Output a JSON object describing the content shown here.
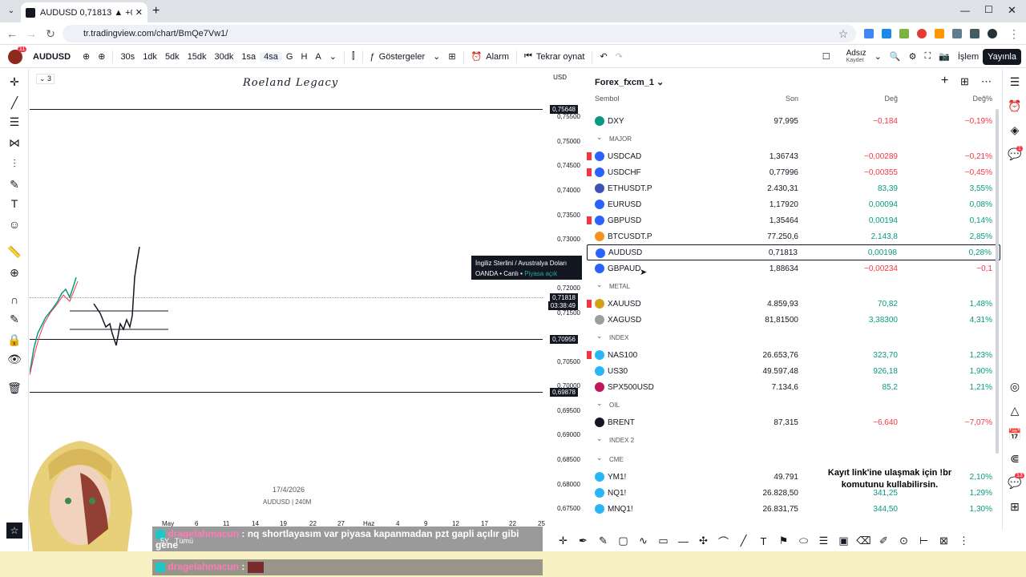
{
  "browser": {
    "tab_title": "AUDUSD 0,71813 ▲ +0,28% Ac",
    "url": "tr.tradingview.com/chart/BmQe7Vw1/"
  },
  "toolbar": {
    "symbol": "AUDUSD",
    "intervals": [
      "30s",
      "1dk",
      "5dk",
      "15dk",
      "30dk",
      "1sa",
      "4sa",
      "G",
      "H",
      "A"
    ],
    "indicators": "Göstergeler",
    "alarm": "Alarm",
    "replay": "Tekrar oynat",
    "layout_name": "Adsız",
    "layout_sub": "Kaydet",
    "trade": "İşlem",
    "publish": "Yayınla"
  },
  "chart": {
    "title": "Roeland Legacy",
    "legend_count": "3",
    "currency": "USD",
    "price_ticks": [
      "0,75500",
      "0,75000",
      "0,74500",
      "0,74000",
      "0,73500",
      "0,73000",
      "0,72000",
      "0,71500",
      "0,70500",
      "0,70000",
      "0,69500",
      "0,69000",
      "0,68500",
      "0,68000",
      "0,67500"
    ],
    "level_badges": [
      "0,75648",
      "0,71818",
      "03:38:49",
      "0,70956",
      "0,69878"
    ],
    "x_ticks": [
      "May",
      "6",
      "11",
      "14",
      "19",
      "22",
      "27",
      "Haz",
      "4",
      "9",
      "12",
      "17",
      "22",
      "25"
    ],
    "watermark_date": "17/4/2026",
    "watermark_sym": "AUDUSD | 240M",
    "tooltip_title": "İngiliz Sterlini / Avustralya Doları",
    "tooltip_broker": "OANDA",
    "tooltip_live": "Canlı",
    "tooltip_market": "Piyasa açık",
    "range_label": "5Y",
    "all_label": "Tümü"
  },
  "watchlist": {
    "name": "Forex_fxcm_1",
    "headers": {
      "symbol": "Sembol",
      "last": "Son",
      "chg": "Değ",
      "pct": "Değ%"
    },
    "rows": [
      {
        "type": "row",
        "sym": "DXY",
        "last": "97,995",
        "chg": "−0,184",
        "pct": "−0,19%",
        "dir": "neg",
        "color": "#089981",
        "flag": false
      },
      {
        "type": "sect",
        "label": "MAJOR"
      },
      {
        "type": "row",
        "sym": "USDCAD",
        "last": "1,36743",
        "chg": "−0,00289",
        "pct": "−0,21%",
        "dir": "neg",
        "color": "#2962ff",
        "flag": true
      },
      {
        "type": "row",
        "sym": "USDCHF",
        "last": "0,77996",
        "chg": "−0,00355",
        "pct": "−0,45%",
        "dir": "neg",
        "color": "#2962ff",
        "flag": true
      },
      {
        "type": "row",
        "sym": "ETHUSDT.P",
        "last": "2.430,31",
        "chg": "83,39",
        "pct": "3,55%",
        "dir": "pos",
        "color": "#3f51b5",
        "flag": false
      },
      {
        "type": "row",
        "sym": "EURUSD",
        "last": "1,17920",
        "chg": "0,00094",
        "pct": "0,08%",
        "dir": "pos",
        "color": "#2962ff",
        "flag": false
      },
      {
        "type": "row",
        "sym": "GBPUSD",
        "last": "1,35464",
        "chg": "0,00194",
        "pct": "0,14%",
        "dir": "pos",
        "color": "#2962ff",
        "flag": true
      },
      {
        "type": "row",
        "sym": "BTCUSDT.P",
        "last": "77.250,6",
        "chg": "2.143,8",
        "pct": "2,85%",
        "dir": "pos",
        "color": "#f7931a",
        "flag": false
      },
      {
        "type": "row",
        "sym": "AUDUSD",
        "last": "0,71813",
        "chg": "0,00198",
        "pct": "0,28%",
        "dir": "pos",
        "color": "#2962ff",
        "flag": false,
        "selected": true
      },
      {
        "type": "row",
        "sym": "GBPAUD",
        "last": "1,88634",
        "chg": "−0,00234",
        "pct": "−0,1",
        "dir": "neg",
        "color": "#2962ff",
        "flag": false
      },
      {
        "type": "sect",
        "label": "METAL"
      },
      {
        "type": "row",
        "sym": "XAUUSD",
        "last": "4.859,93",
        "chg": "70,82",
        "pct": "1,48%",
        "dir": "pos",
        "color": "#d4a017",
        "flag": true
      },
      {
        "type": "row",
        "sym": "XAGUSD",
        "last": "81,81500",
        "chg": "3,38300",
        "pct": "4,31%",
        "dir": "pos",
        "color": "#9e9e9e",
        "flag": false
      },
      {
        "type": "sect",
        "label": "INDEX"
      },
      {
        "type": "row",
        "sym": "NAS100",
        "last": "26.653,76",
        "chg": "323,70",
        "pct": "1,23%",
        "dir": "pos",
        "color": "#29b6f6",
        "flag": true
      },
      {
        "type": "row",
        "sym": "US30",
        "last": "49.597,48",
        "chg": "926,18",
        "pct": "1,90%",
        "dir": "pos",
        "color": "#29b6f6",
        "flag": false
      },
      {
        "type": "row",
        "sym": "SPX500USD",
        "last": "7.134,6",
        "chg": "85,2",
        "pct": "1,21%",
        "dir": "pos",
        "color": "#c2185b",
        "flag": false
      },
      {
        "type": "sect",
        "label": "OIL"
      },
      {
        "type": "row",
        "sym": "BRENT",
        "last": "87,315",
        "chg": "−6,640",
        "pct": "−7,07%",
        "dir": "neg",
        "color": "#131722",
        "flag": false
      },
      {
        "type": "sect",
        "label": "INDEX 2"
      },
      {
        "type": "sect",
        "label": "CME"
      },
      {
        "type": "row",
        "sym": "YM1!",
        "last": "49.791",
        "chg": "",
        "pct": "2,10%",
        "dir": "pos",
        "color": "#29b6f6",
        "flag": false
      },
      {
        "type": "row",
        "sym": "NQ1!",
        "last": "26.828,50",
        "chg": "341,25",
        "pct": "1,29%",
        "dir": "pos",
        "color": "#29b6f6",
        "flag": false
      },
      {
        "type": "row",
        "sym": "MNQ1!",
        "last": "26.831,75",
        "chg": "344,50",
        "pct": "1,30%",
        "dir": "pos",
        "color": "#29b6f6",
        "flag": false
      }
    ]
  },
  "chat": {
    "user": "dragelahmacun",
    "msg1": ": nq shortlayasım var piyasa kapanmadan pzt gapli açılır gibi gene",
    "msg2": ":"
  },
  "overlay": {
    "line1": "Kayıt link'ine ulaşmak için !br",
    "line2": "komutunu kullabilirsin."
  },
  "badges": {
    "notif": "11",
    "right1": "1",
    "right2": "13"
  }
}
